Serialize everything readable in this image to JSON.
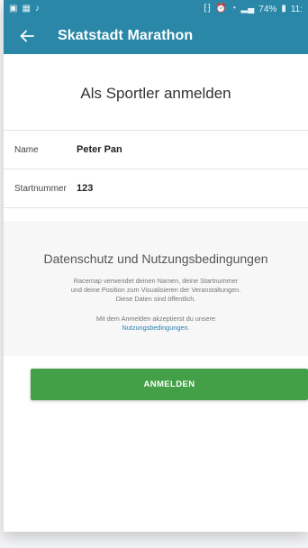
{
  "status_bar": {
    "battery_text": "74%",
    "time_text": "11:"
  },
  "app_bar": {
    "title": "Skatstadt Marathon"
  },
  "page": {
    "heading": "Als Sportler anmelden"
  },
  "form": {
    "name_label": "Name",
    "name_value": "Peter Pan",
    "bib_label": "Startnummer",
    "bib_value": "123"
  },
  "privacy": {
    "title": "Datenschutz und Nutzungsbedingungen",
    "line1": "Racemap verwendet deinen Namen, deine Startnummer",
    "line2": "und deine Position zum Visualisieren der Veranstaltungen.",
    "line3": "Diese Daten sind öffentlich.",
    "consent_line": "Mit dem Anmelden akzeptierst du unsere",
    "terms_link": "Nutzungsbedingungen",
    "terms_suffix": "."
  },
  "actions": {
    "register_label": "ANMELDEN"
  },
  "colors": {
    "primary": "#2a87a8",
    "button": "#43a047",
    "link": "#2a7fb0"
  }
}
